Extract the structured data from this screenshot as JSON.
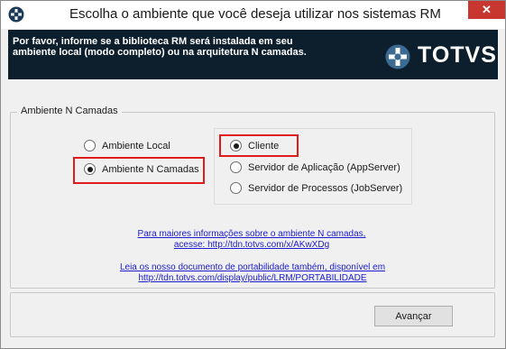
{
  "window": {
    "title": "Escolha o ambiente que você deseja utilizar nos sistemas RM",
    "close_glyph": "✕"
  },
  "banner": {
    "text": "Por favor, informe se a biblioteca RM será instalada em seu ambiente local (modo completo) ou na arquitetura N camadas.",
    "logo_text": "TOTVS",
    "background": "#0d1f2d"
  },
  "group": {
    "legend": "Ambiente N Camadas",
    "options": [
      {
        "label": "Ambiente Local",
        "checked": false
      },
      {
        "label": "Ambiente N Camadas",
        "checked": true
      }
    ],
    "sub_options": [
      {
        "label": "Cliente",
        "checked": true
      },
      {
        "label": "Servidor de Aplicação (AppServer)",
        "checked": false
      },
      {
        "label": "Servidor de Processos (JobServer)",
        "checked": false
      }
    ]
  },
  "links": {
    "info_line1": "Para maiores informações sobre o ambiente N camadas,",
    "info_line2": "acesse: http://tdn.totvs.com/x/AKwXDg",
    "doc_line1": "Leia os nosso documento de portabilidade também, disponível em",
    "doc_line2": "http://tdn.totvs.com/display/public/LRM/PORTABILIDADE"
  },
  "buttons": {
    "next": "Avançar"
  },
  "colors": {
    "highlight": "#e01b1b",
    "link": "#1c1cd0",
    "close": "#c7372f"
  }
}
